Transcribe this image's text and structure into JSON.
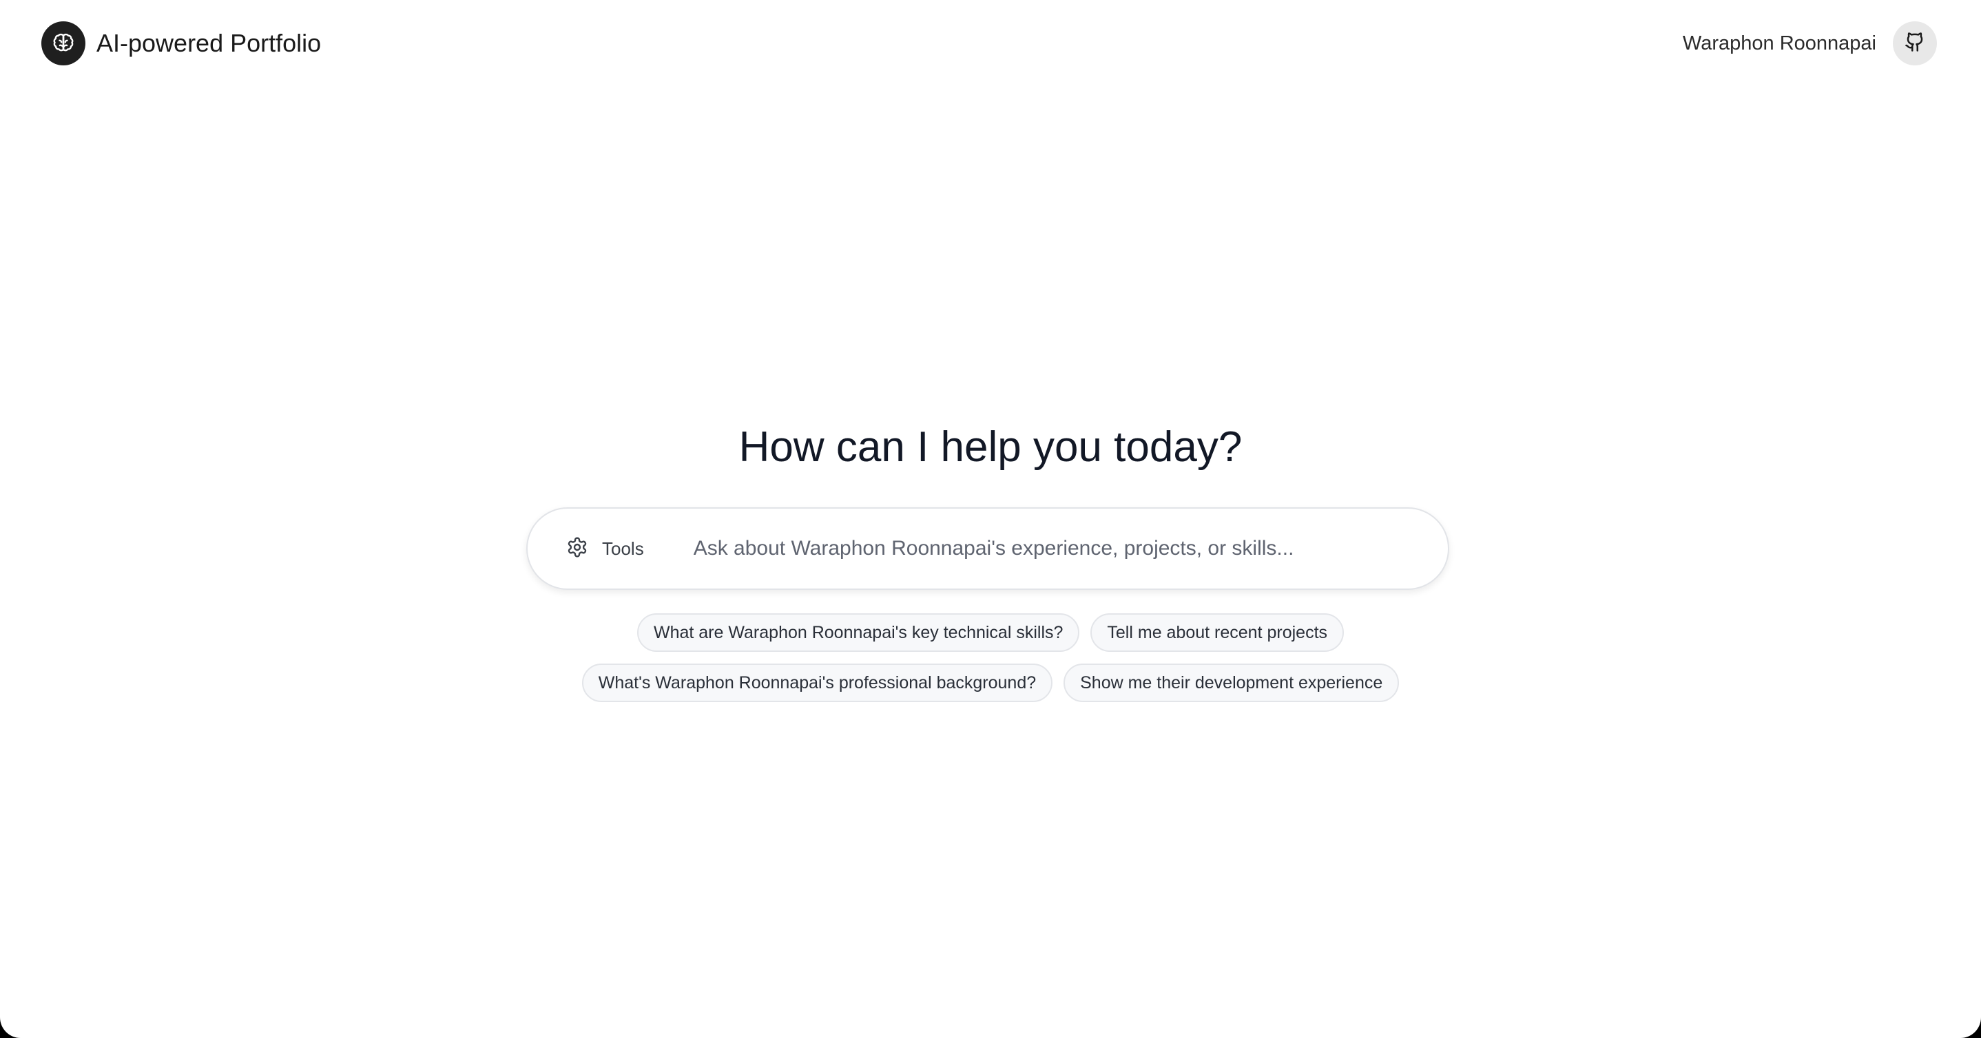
{
  "header": {
    "brand_icon": "brain-icon",
    "app_title": "AI-powered Portfolio",
    "user_name": "Waraphon Roonnapai",
    "github_icon": "github-icon"
  },
  "main": {
    "heading": "How can I help you today?",
    "search": {
      "tools_icon": "gear-icon",
      "tools_label": "Tools",
      "placeholder": "Ask about Waraphon Roonnapai's experience, projects, or skills...",
      "value": ""
    },
    "suggestions": [
      [
        "What are Waraphon Roonnapai's key technical skills?",
        "Tell me about recent projects"
      ],
      [
        "What's Waraphon Roonnapai's professional background?",
        "Show me their development experience"
      ]
    ]
  },
  "colors": {
    "brand_bg": "#1f1f1f",
    "github_bg": "#e8e8e8",
    "chip_bg": "#f7f8fa",
    "heading_text": "#121826"
  }
}
